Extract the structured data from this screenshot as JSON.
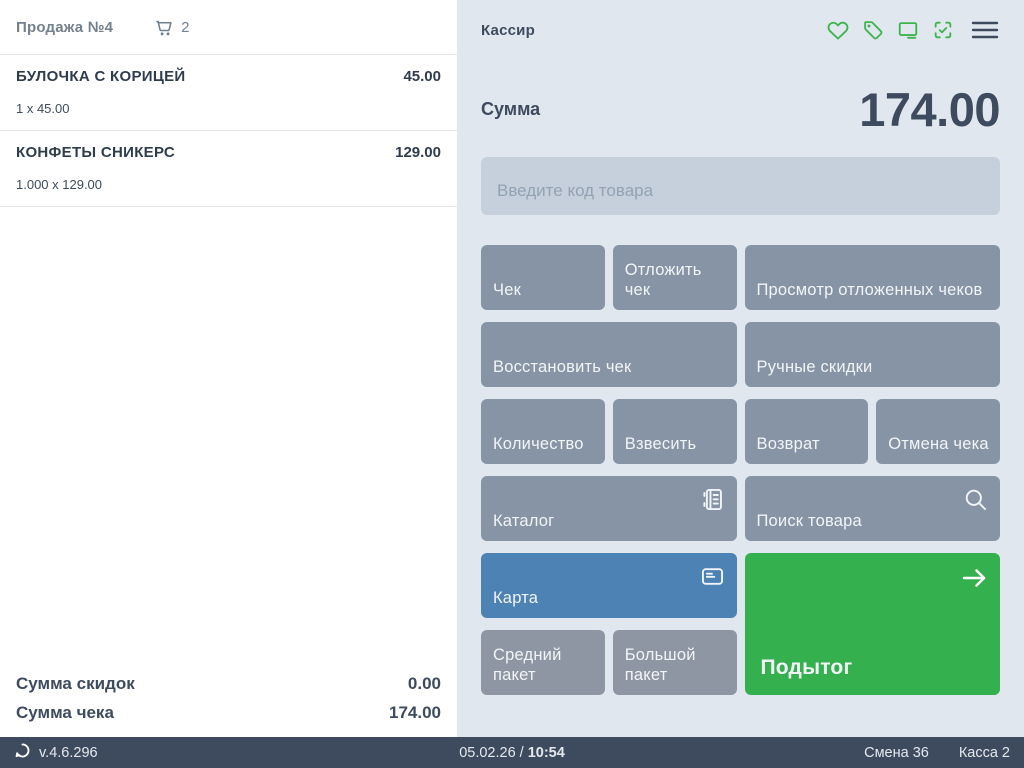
{
  "left_panel": {
    "header": {
      "title": "Продажа №4",
      "cart_count": "2"
    },
    "items": [
      {
        "name": "БУЛОЧКА С КОРИЦЕЙ",
        "price": "45.00",
        "qty": "1 x 45.00"
      },
      {
        "name": "КОНФЕТЫ СНИКЕРС",
        "price": "129.00",
        "qty": "1.000 x 129.00"
      }
    ],
    "totals": {
      "discount_label": "Сумма скидок",
      "discount_value": "0.00",
      "total_label": "Сумма чека",
      "total_value": "174.00"
    }
  },
  "right_panel": {
    "cashier_label": "Кассир",
    "sum_label": "Сумма",
    "sum_value": "174.00",
    "input_placeholder": "Введите код товара",
    "buttons": {
      "cheque": "Чек",
      "hold_cheque": "Отложить чек",
      "view_held": "Просмотр отложенных чеков",
      "restore_cheque": "Восстановить чек",
      "manual_discounts": "Ручные скидки",
      "quantity": "Количество",
      "weigh": "Взвесить",
      "refund": "Возврат",
      "cancel_cheque": "Отмена чека",
      "catalog": "Каталог",
      "product_search": "Поиск товара",
      "card": "Карта",
      "subtotal": "Подытог",
      "medium_bag": "Средний пакет",
      "large_bag": "Большой пакет"
    },
    "icons": [
      "heart-icon",
      "tag-icon",
      "monitor-icon",
      "scan-check-icon",
      "menu-icon"
    ]
  },
  "status_bar": {
    "version": "v.4.6.296",
    "date": "05.02.26 / ",
    "time": "10:54",
    "shift": "Смена 36",
    "register": "Касса 2"
  },
  "colors": {
    "accent_green": "#35b04e",
    "accent_blue": "#4d82b4",
    "button_gray": "#8694a5",
    "panel_bg": "#e1e7ee",
    "bar_bg": "#3e4b5f",
    "text_dark": "#3e4b5e"
  }
}
